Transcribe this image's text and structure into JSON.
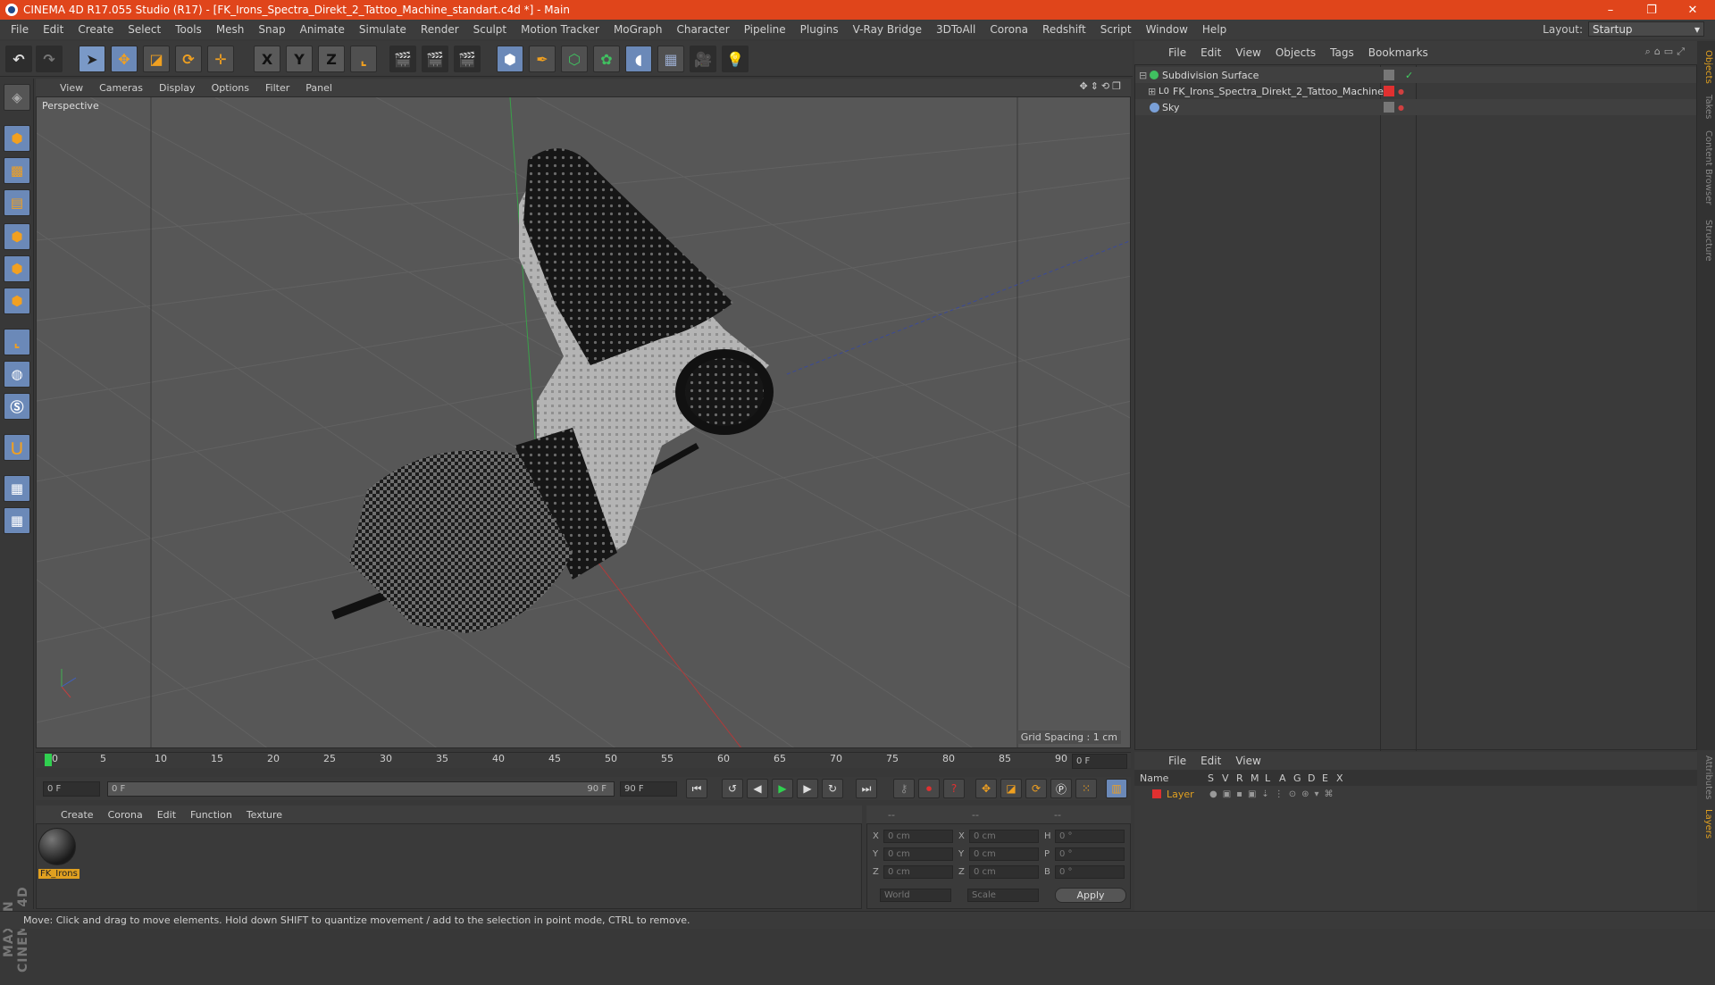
{
  "window": {
    "title": "CINEMA 4D R17.055 Studio (R17) - [FK_Irons_Spectra_Direkt_2_Tattoo_Machine_standart.c4d *] - Main",
    "controls": [
      "–",
      "❐",
      "✕"
    ]
  },
  "menubar": {
    "items": [
      "File",
      "Edit",
      "Create",
      "Select",
      "Tools",
      "Mesh",
      "Snap",
      "Animate",
      "Simulate",
      "Render",
      "Sculpt",
      "Motion Tracker",
      "MoGraph",
      "Character",
      "Pipeline",
      "Plugins",
      "V-Ray Bridge",
      "3DToAll",
      "Corona",
      "Redshift",
      "Script",
      "Window",
      "Help"
    ],
    "layout_label": "Layout:",
    "layout_value": "Startup"
  },
  "toolbar": {
    "axis_x": "X",
    "axis_y": "Y",
    "axis_z": "Z"
  },
  "viewport": {
    "menu": [
      "View",
      "Cameras",
      "Display",
      "Options",
      "Filter",
      "Panel"
    ],
    "label": "Perspective",
    "grid_spacing": "Grid Spacing : 1 cm"
  },
  "objects": {
    "menu": [
      "File",
      "Edit",
      "View",
      "Objects",
      "Tags",
      "Bookmarks"
    ],
    "rows": [
      {
        "name": "Subdivision Surface",
        "icon": "subdivision-icon"
      },
      {
        "name": "FK_Irons_Spectra_Direkt_2_Tattoo_Machine",
        "icon": "null-object-icon"
      },
      {
        "name": "Sky",
        "icon": "sky-icon"
      }
    ],
    "side_tabs": [
      "Objects",
      "Takes",
      "Content Browser",
      "Structure"
    ]
  },
  "layers": {
    "menu": [
      "File",
      "Edit",
      "View"
    ],
    "columns": [
      "Name",
      "S",
      "V",
      "R",
      "M",
      "L",
      "A",
      "G",
      "D",
      "E",
      "X"
    ],
    "rows": [
      {
        "name": "Layer",
        "color": "#e03030"
      }
    ],
    "side_tabs": [
      "Attributes",
      "Layers"
    ]
  },
  "timeline": {
    "ticks": [
      "0",
      "5",
      "10",
      "15",
      "20",
      "25",
      "30",
      "35",
      "40",
      "45",
      "50",
      "55",
      "60",
      "65",
      "70",
      "75",
      "80",
      "85",
      "90"
    ],
    "current_frame": "0 F",
    "start_field": "0 F",
    "range_start": "0 F",
    "range_end": "90 F",
    "end_field": "90 F"
  },
  "materials": {
    "menu": [
      "Create",
      "Corona",
      "Edit",
      "Function",
      "Texture"
    ],
    "items": [
      {
        "name": "FK_Irons"
      }
    ]
  },
  "coordinates": {
    "headers": [
      "--",
      "--",
      "--"
    ],
    "rows": [
      {
        "a": "X",
        "av": "0 cm",
        "b": "X",
        "bv": "0 cm",
        "c": "H",
        "cv": "0 °"
      },
      {
        "a": "Y",
        "av": "0 cm",
        "b": "Y",
        "bv": "0 cm",
        "c": "P",
        "cv": "0 °"
      },
      {
        "a": "Z",
        "av": "0 cm",
        "b": "Z",
        "bv": "0 cm",
        "c": "B",
        "cv": "0 °"
      }
    ],
    "mode1": "World",
    "mode2": "Scale",
    "apply": "Apply"
  },
  "branding": "MAXON CINEMA 4D",
  "status": "Move: Click and drag to move elements. Hold down SHIFT to quantize movement / add to the selection in point mode, CTRL to remove."
}
